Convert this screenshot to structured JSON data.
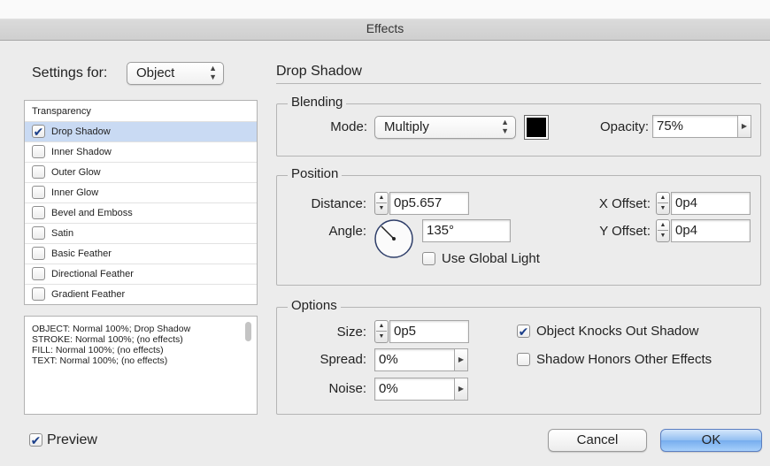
{
  "window": {
    "title": "Effects"
  },
  "settings_for": {
    "label": "Settings for:",
    "value": "Object"
  },
  "effects_list": {
    "header": "Transparency",
    "items": [
      {
        "label": "Drop Shadow",
        "checked": true,
        "selected": true
      },
      {
        "label": "Inner Shadow",
        "checked": false,
        "selected": false
      },
      {
        "label": "Outer Glow",
        "checked": false,
        "selected": false
      },
      {
        "label": "Inner Glow",
        "checked": false,
        "selected": false
      },
      {
        "label": "Bevel and Emboss",
        "checked": false,
        "selected": false
      },
      {
        "label": "Satin",
        "checked": false,
        "selected": false
      },
      {
        "label": "Basic Feather",
        "checked": false,
        "selected": false
      },
      {
        "label": "Directional Feather",
        "checked": false,
        "selected": false
      },
      {
        "label": "Gradient Feather",
        "checked": false,
        "selected": false
      }
    ]
  },
  "summary": {
    "lines": [
      "OBJECT: Normal 100%; Drop Shadow",
      "STROKE: Normal 100%; (no effects)",
      "FILL: Normal 100%; (no effects)",
      "TEXT: Normal 100%; (no effects)"
    ]
  },
  "panel": {
    "title": "Drop Shadow"
  },
  "blending": {
    "title": "Blending",
    "mode_label": "Mode:",
    "mode_value": "Multiply",
    "color": "#000000",
    "opacity_label": "Opacity:",
    "opacity_value": "75%"
  },
  "position": {
    "title": "Position",
    "distance_label": "Distance:",
    "distance_value": "0p5.657",
    "angle_label": "Angle:",
    "angle_value": "135°",
    "use_global_light_label": "Use Global Light",
    "x_offset_label": "X Offset:",
    "x_offset_value": "0p4",
    "y_offset_label": "Y Offset:",
    "y_offset_value": "0p4"
  },
  "options": {
    "title": "Options",
    "size_label": "Size:",
    "size_value": "0p5",
    "spread_label": "Spread:",
    "spread_value": "0%",
    "noise_label": "Noise:",
    "noise_value": "0%",
    "knocks_out_label": "Object Knocks Out Shadow",
    "honors_label": "Shadow Honors Other Effects"
  },
  "footer": {
    "preview_label": "Preview",
    "cancel_label": "Cancel",
    "ok_label": "OK"
  },
  "icons": {
    "checkmark": "✔",
    "stepper": "stepper-arrows-icon",
    "popup": "triangle-right-icon"
  }
}
